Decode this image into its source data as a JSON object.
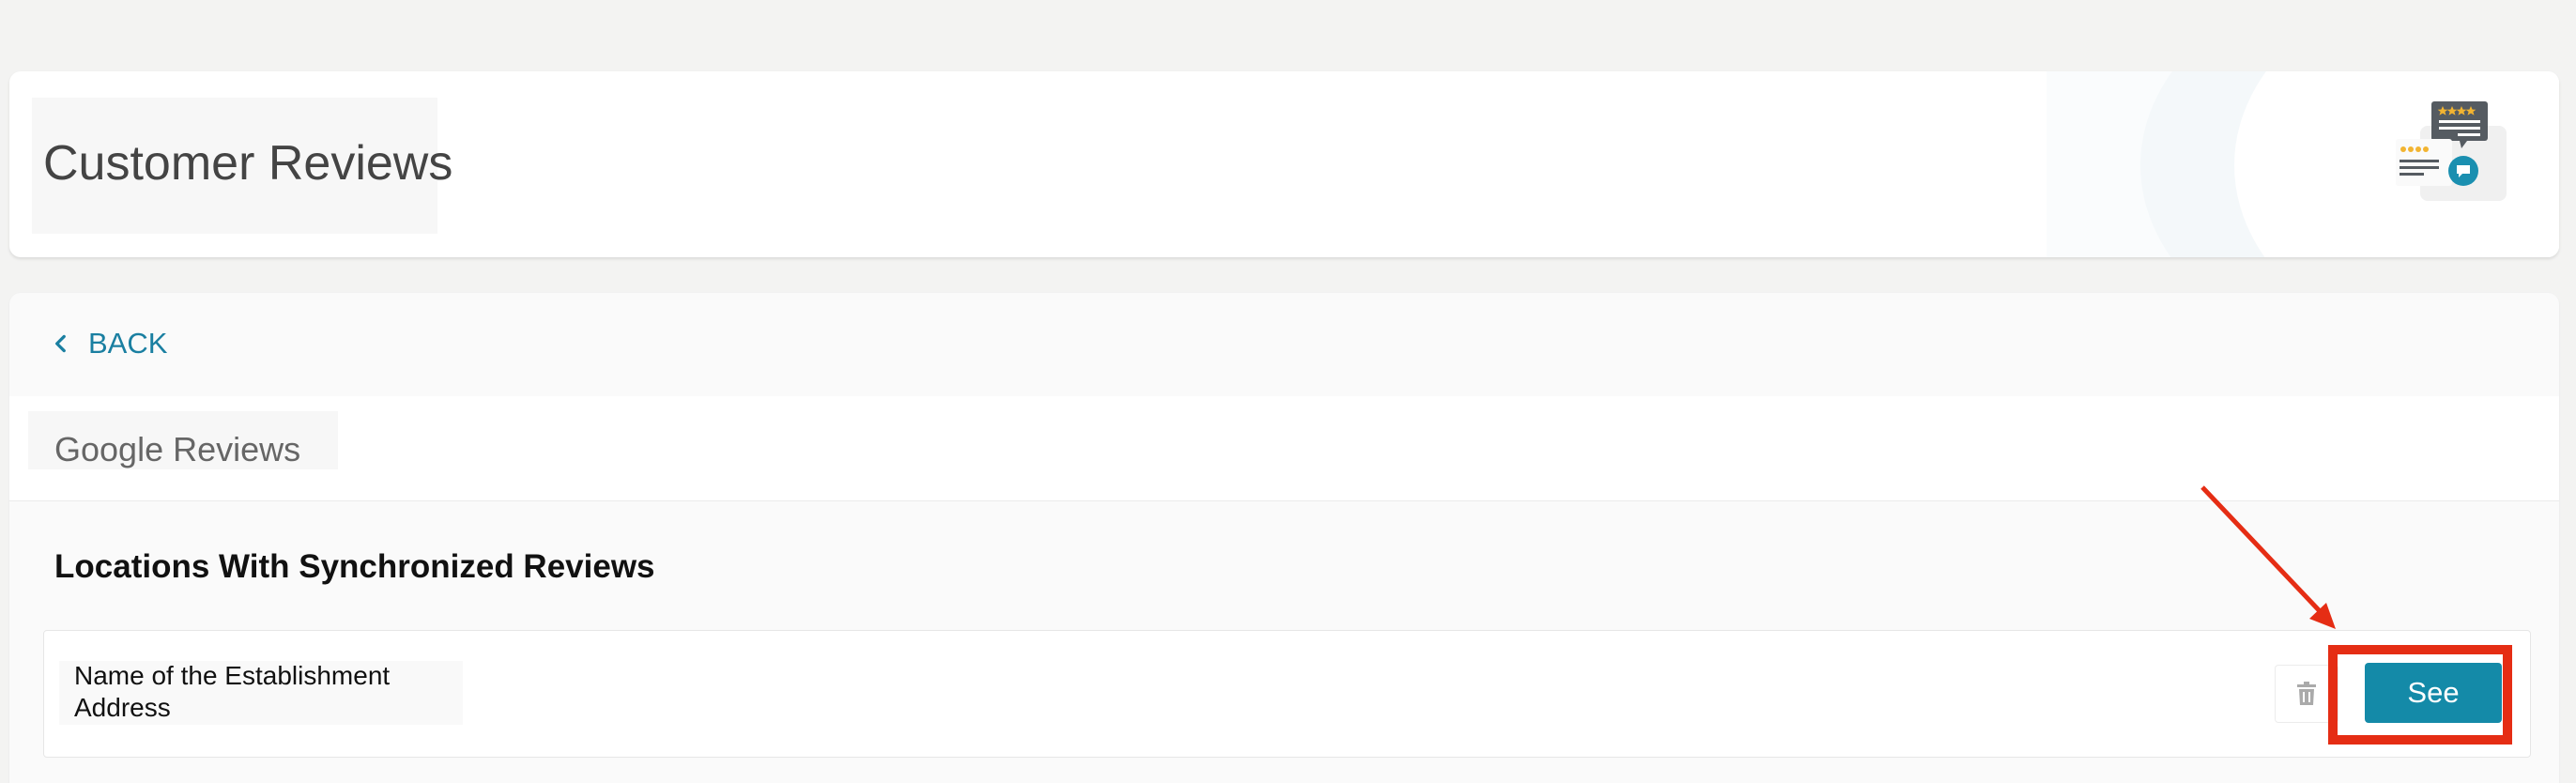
{
  "header": {
    "title": "Customer Reviews"
  },
  "navigation": {
    "back_label": "BACK"
  },
  "tabs": [
    {
      "label": "Google Reviews",
      "active": true
    }
  ],
  "section": {
    "title": "Locations With Synchronized Reviews"
  },
  "locations": [
    {
      "name": "Name of the Establishment",
      "address": "Address",
      "see_label": "See"
    }
  ],
  "icons": {
    "back": "chevron-left-icon",
    "delete": "trash-icon",
    "illustration": "reviews-illustration-icon"
  },
  "colors": {
    "accent": "#148aa8",
    "link": "#1a7fa1",
    "annotation": "#e52d14",
    "star": "#f2b431"
  }
}
